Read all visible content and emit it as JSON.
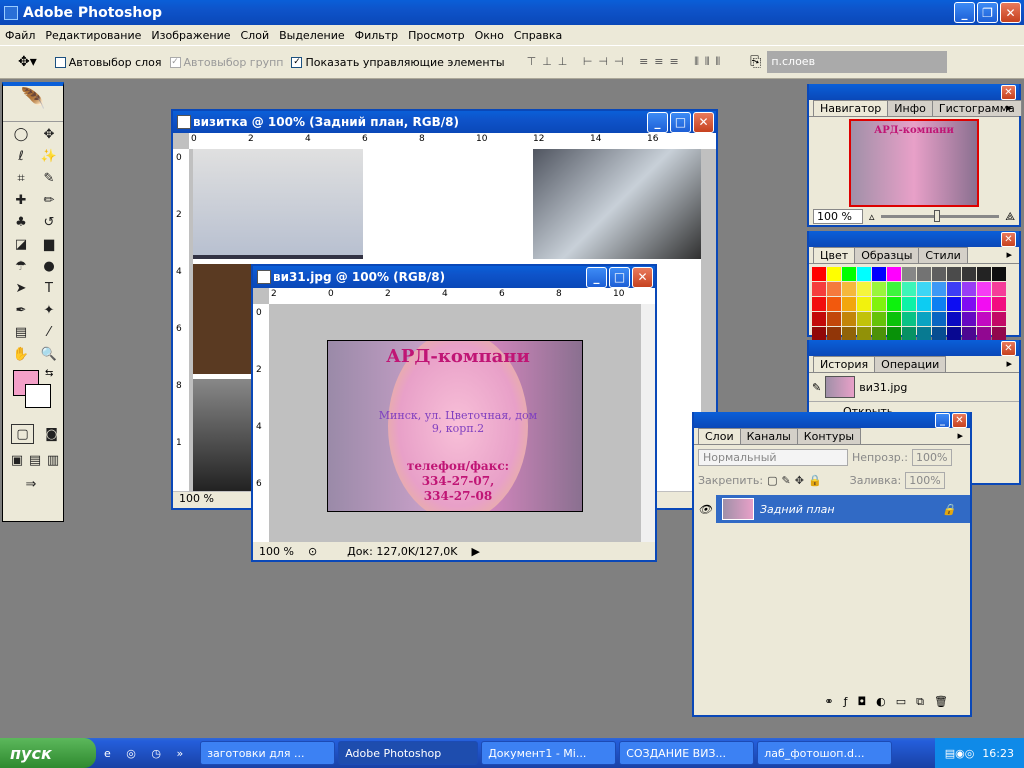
{
  "app": {
    "title": "Adobe Photoshop"
  },
  "menu": [
    "Файл",
    "Редактирование",
    "Изображение",
    "Слой",
    "Выделение",
    "Фильтр",
    "Просмотр",
    "Окно",
    "Справка"
  ],
  "options": {
    "auto_select_layer": "Автовыбор слоя",
    "auto_select_groups": "Автовыбор групп",
    "show_controls": "Показать управляющие элементы",
    "layers_field": "п.слоев"
  },
  "doc1": {
    "title": "визитка @ 100% (Задний план, RGB/8)",
    "zoom": "100 %",
    "ruler_h": [
      "0",
      "2",
      "4",
      "6",
      "8",
      "10",
      "12",
      "14",
      "16"
    ],
    "ruler_v": [
      "0",
      "2",
      "4",
      "6",
      "8",
      "1"
    ]
  },
  "doc2": {
    "title": "ви31.jpg @ 100% (RGB/8)",
    "zoom": "100 %",
    "status": "Док: 127,0K/127,0K",
    "ruler_h": [
      "2",
      "0",
      "2",
      "4",
      "6",
      "8",
      "10"
    ],
    "ruler_v": [
      "0",
      "2",
      "4",
      "6"
    ]
  },
  "card": {
    "company": "АРД-компани",
    "address": "Минск, ул. Цветочная, дом 9, корп.2",
    "phone_label": "телефон/факс:",
    "phone1": "334-27-07,",
    "phone2": "334-27-08"
  },
  "navigator": {
    "tabs": [
      "Навигатор",
      "Инфо",
      "Гистограмма"
    ],
    "zoom": "100 %"
  },
  "swatches": {
    "tabs": [
      "Цвет",
      "Образцы",
      "Стили"
    ]
  },
  "history": {
    "tabs": [
      "История",
      "Операции"
    ],
    "snapshot": "ви31.jpg",
    "item1": "Открыть"
  },
  "layers": {
    "tabs": [
      "Слои",
      "Каналы",
      "Контуры"
    ],
    "blend": "Нормальный",
    "opacity_label": "Непрозр.:",
    "opacity": "100%",
    "lock_label": "Закрепить:",
    "fill_label": "Заливка:",
    "fill": "100%",
    "layer_name": "Задний план"
  },
  "taskbar": {
    "start": "пуск",
    "time": "16:23",
    "tasks": [
      "заготовки для ...",
      "Adobe Photoshop",
      "Документ1 - Mi...",
      "СОЗДАНИЕ ВИЗ...",
      "лаб_фотошоп.d..."
    ]
  },
  "colors": {
    "foreground": "#f4a0c8",
    "background": "#ffffff",
    "accent": "#0a48b8"
  }
}
